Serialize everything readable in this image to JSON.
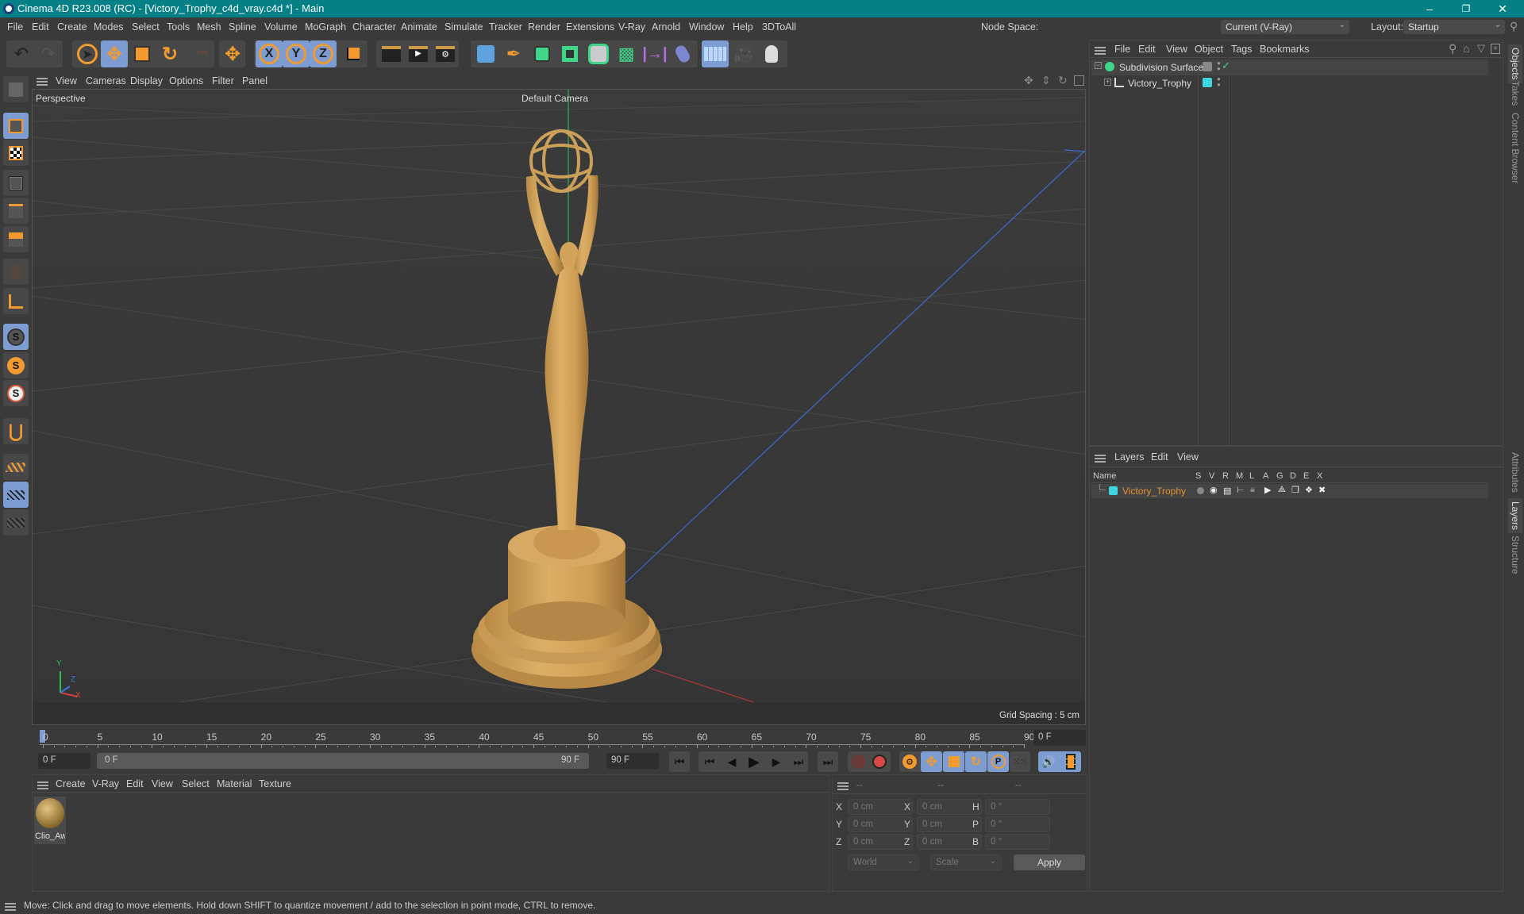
{
  "window": {
    "title": "Cinema 4D R23.008 (RC) - [Victory_Trophy_c4d_vray.c4d *] - Main",
    "minimize": "–",
    "restore": "❐",
    "close": "✕"
  },
  "menubar": {
    "items": [
      "File",
      "Edit",
      "Create",
      "Modes",
      "Select",
      "Tools",
      "Mesh",
      "Spline",
      "Volume",
      "MoGraph",
      "Character",
      "Animate",
      "Simulate",
      "Tracker",
      "Render",
      "Extensions",
      "V-Ray",
      "Arnold",
      "Window",
      "Help",
      "3DToAll"
    ],
    "node_space_label": "Node Space:",
    "node_space_value": "Current (V-Ray)",
    "layout_label": "Layout:",
    "layout_value": "Startup"
  },
  "toolbar": {
    "axis_x": "X",
    "axis_y": "Y",
    "axis_z": "Z",
    "psr": "PSR"
  },
  "viewport": {
    "menu": [
      "View",
      "Cameras",
      "Display",
      "Options",
      "Filter",
      "Panel"
    ],
    "view_name": "Perspective",
    "camera": "Default Camera",
    "grid_spacing": "Grid Spacing : 5 cm",
    "axis_labels": {
      "x": "X",
      "y": "Y",
      "z": "Z"
    }
  },
  "timeline": {
    "ticks": [
      "0",
      "5",
      "10",
      "15",
      "20",
      "25",
      "30",
      "35",
      "40",
      "45",
      "50",
      "55",
      "60",
      "65",
      "70",
      "75",
      "80",
      "85",
      "90"
    ],
    "current_frame": "0 F",
    "start_field": "0 F",
    "range_start": "0 F",
    "range_end": "90 F",
    "end_field": "90 F"
  },
  "material_manager": {
    "menu": [
      "Create",
      "V-Ray",
      "Edit",
      "View",
      "Select",
      "Material",
      "Texture"
    ],
    "materials": [
      {
        "name": "Clio_Awa"
      }
    ]
  },
  "coordinates": {
    "headers": [
      "--",
      "--",
      "--"
    ],
    "rows": [
      {
        "l1": "X",
        "v1": "0 cm",
        "l2": "X",
        "v2": "0 cm",
        "l3": "H",
        "v3": "0 °"
      },
      {
        "l1": "Y",
        "v1": "0 cm",
        "l2": "Y",
        "v2": "0 cm",
        "l3": "P",
        "v3": "0 °"
      },
      {
        "l1": "Z",
        "v1": "0 cm",
        "l2": "Z",
        "v2": "0 cm",
        "l3": "B",
        "v3": "0 °"
      }
    ],
    "coord_system": "World",
    "mode": "Scale",
    "apply": "Apply"
  },
  "objects_panel": {
    "menu": [
      "File",
      "Edit",
      "View",
      "Object",
      "Tags",
      "Bookmarks"
    ],
    "objects": [
      {
        "name": "Subdivision Surface"
      },
      {
        "name": "Victory_Trophy"
      }
    ]
  },
  "layers_panel": {
    "menu": [
      "Layers",
      "Edit",
      "View"
    ],
    "columns": [
      "Name",
      "S",
      "V",
      "R",
      "M",
      "L",
      "A",
      "G",
      "D",
      "E",
      "X"
    ],
    "layers": [
      {
        "name": "Victory_Trophy",
        "color": "#3fd6e0"
      }
    ]
  },
  "side_tabs": {
    "top": [
      "Objects",
      "Takes",
      "Content Browser"
    ],
    "bottom": [
      "Attributes",
      "Layers",
      "Structure"
    ]
  },
  "status": "Move: Click and drag to move elements. Hold down SHIFT to quantize movement / add to the selection in point mode, CTRL to remove.",
  "colors": {
    "titlebar": "#068087",
    "accent_orange": "#f29a2e",
    "active_blue": "#7d9cd1",
    "trophy_gold": "#d4a55a",
    "layer_name": "#e8912f"
  }
}
